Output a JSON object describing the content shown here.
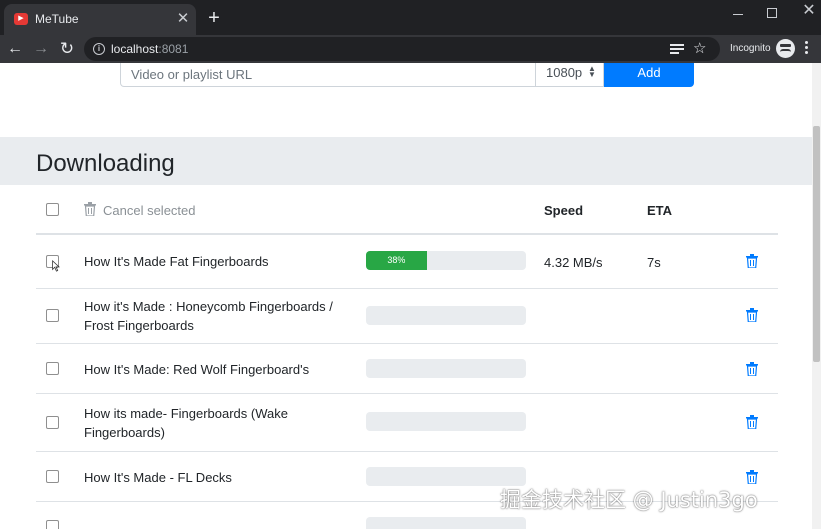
{
  "browser": {
    "tab_title": "MeTube",
    "url_host": "localhost",
    "url_port": ":8081",
    "incognito_label": "Incognito"
  },
  "form": {
    "url_placeholder": "Video or playlist URL",
    "quality_value": "1080p",
    "add_label": "Add"
  },
  "downloading": {
    "title": "Downloading",
    "cancel_selected": "Cancel selected",
    "col_speed": "Speed",
    "col_eta": "ETA",
    "rows": [
      {
        "title": "How It's Made Fat Fingerboards",
        "progress": 38,
        "progress_label": "38%",
        "speed": "4.32 MB/s",
        "eta": "7s"
      },
      {
        "title": "How it's Made : Honeycomb Fingerboards / Frost Fingerboards",
        "progress": 0,
        "progress_label": "",
        "speed": "",
        "eta": ""
      },
      {
        "title": "How It's Made: Red Wolf Fingerboard's",
        "progress": 0,
        "progress_label": "",
        "speed": "",
        "eta": ""
      },
      {
        "title": "How its made- Fingerboards (Wake Fingerboards)",
        "progress": 0,
        "progress_label": "",
        "speed": "",
        "eta": ""
      },
      {
        "title": "How It's Made - FL Decks",
        "progress": 0,
        "progress_label": "",
        "speed": "",
        "eta": ""
      }
    ]
  },
  "colors": {
    "accent": "#007bff",
    "progress": "#28a745",
    "delete_icon": "#007bff",
    "section_bg": "#e9ecef"
  },
  "watermark": "掘金技术社区 @ Justin3go"
}
